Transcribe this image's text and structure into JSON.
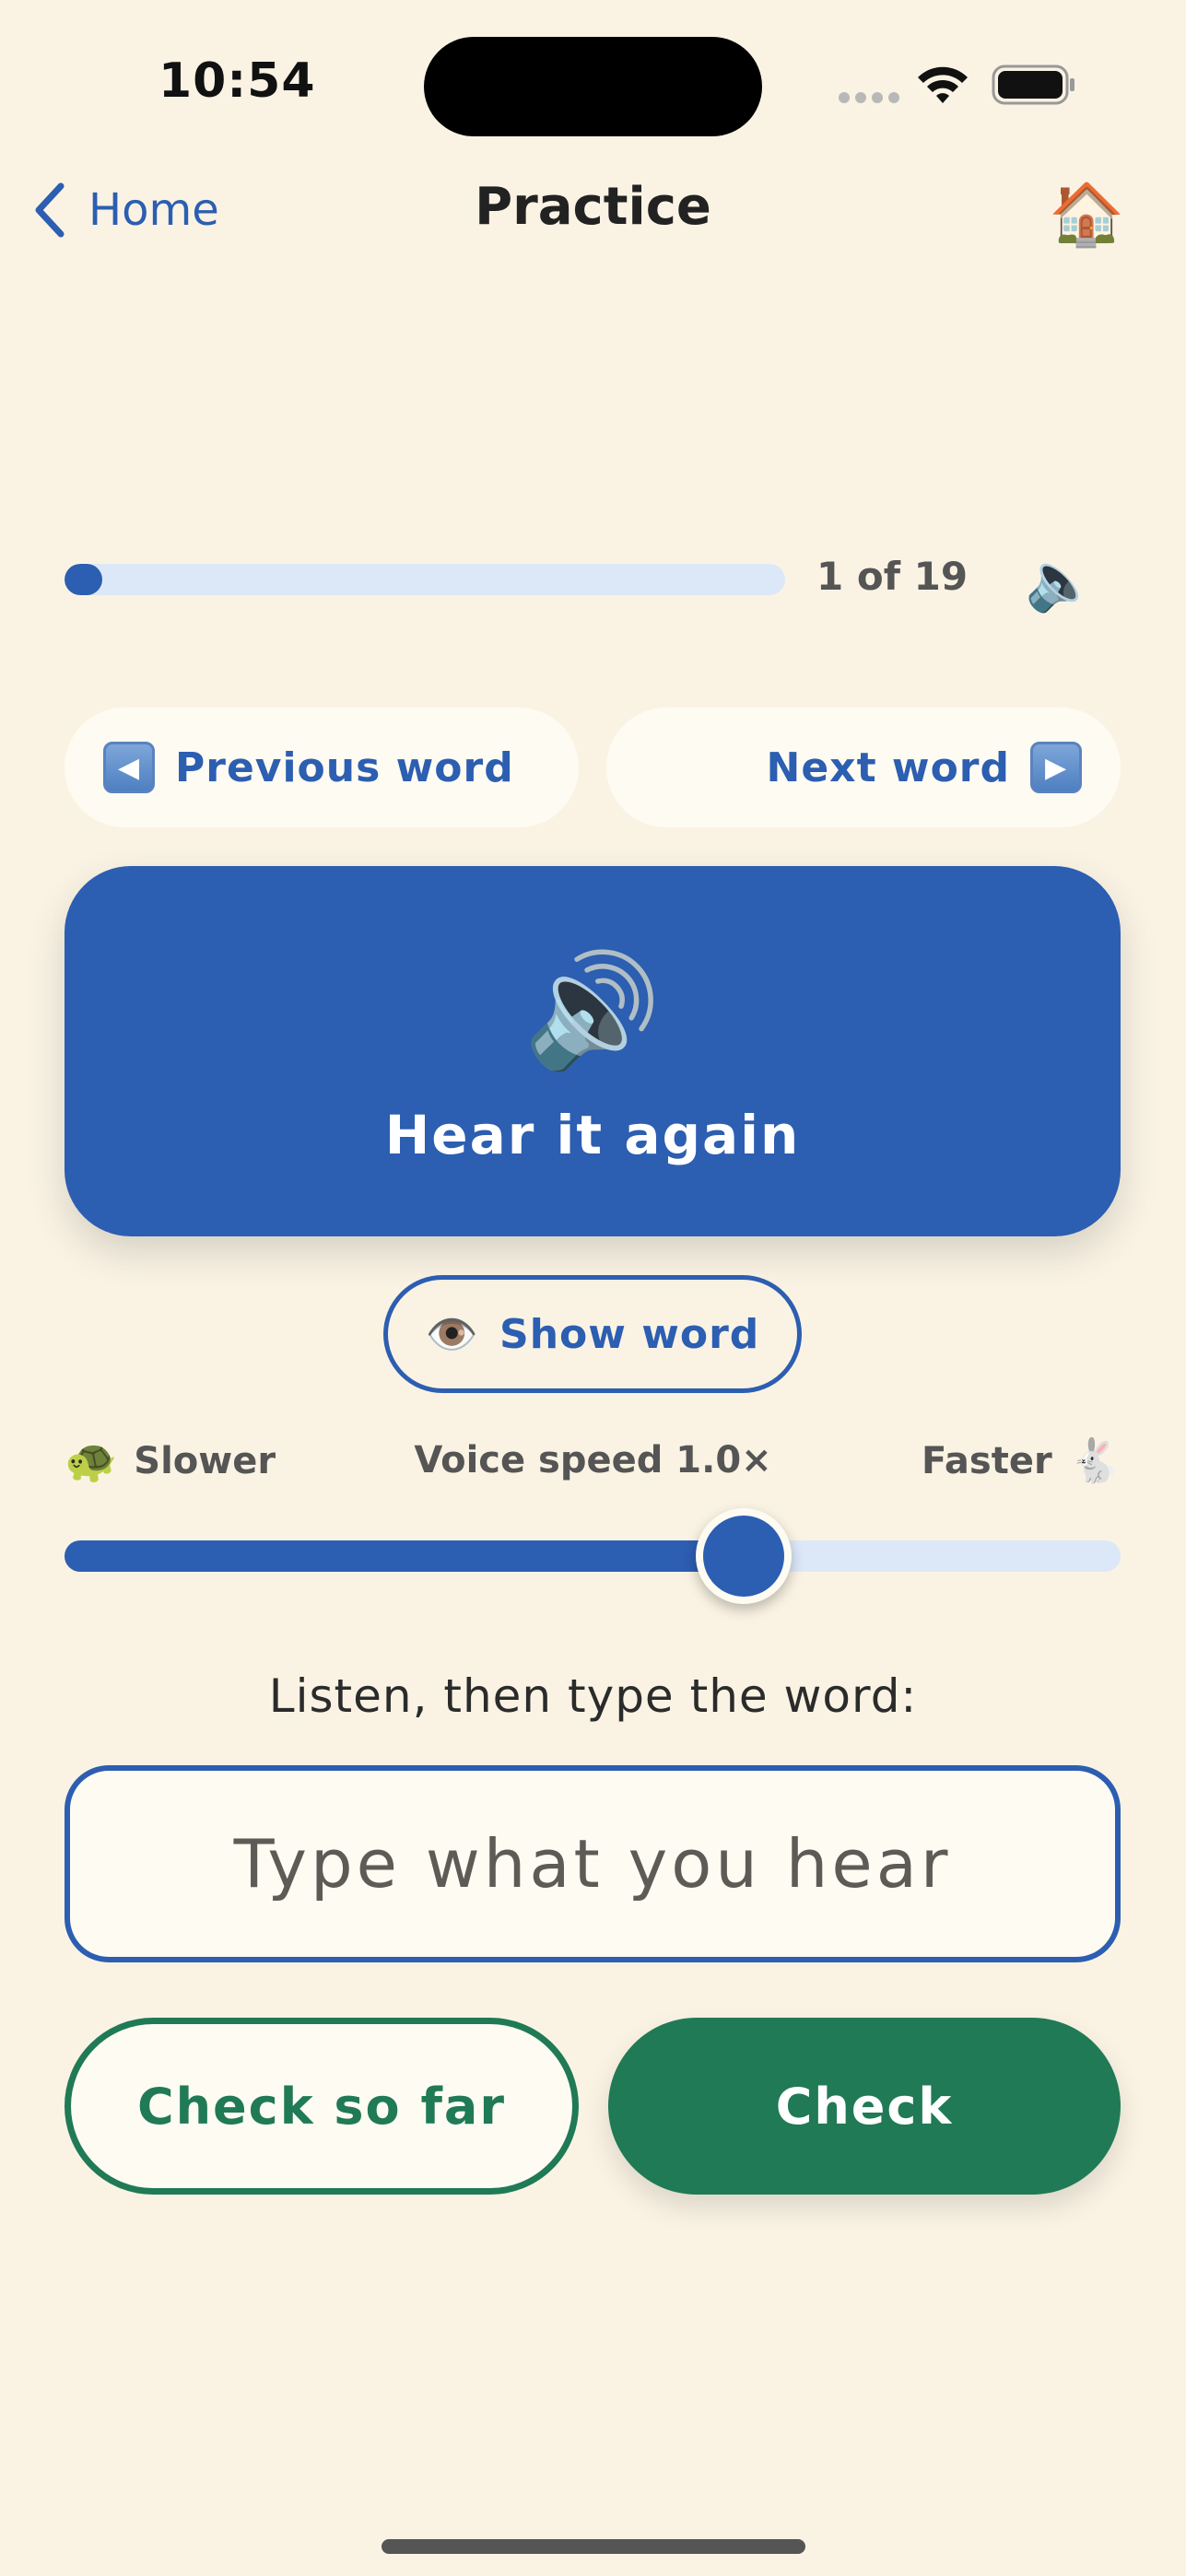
{
  "status_bar": {
    "time": "10:54",
    "icons": [
      "signal-dots-icon",
      "wifi-icon",
      "battery-icon"
    ]
  },
  "nav": {
    "back_label": "Home",
    "title": "Practice",
    "home_icon": "🏠"
  },
  "progress": {
    "label": "1 of 19",
    "current": 1,
    "total": 19,
    "speaker_icon": "🔈"
  },
  "word_nav": {
    "previous_label": "Previous word",
    "next_label": "Next word",
    "previous_icon": "◀",
    "next_icon": "▶"
  },
  "hear": {
    "icon": "🔊",
    "label": "Hear it again"
  },
  "show_word": {
    "icon": "👁️",
    "label": "Show word"
  },
  "speed": {
    "slower_icon": "🐢",
    "slower_label": "Slower",
    "label": "Voice speed 1.0×",
    "faster_label": "Faster",
    "faster_icon": "🐇",
    "level": 0.643
  },
  "prompt": "Listen, then type the word:",
  "answer": {
    "value": "",
    "placeholder": "Type what you hear"
  },
  "actions": {
    "check_so_far_label": "Check so far",
    "check_label": "Check"
  },
  "colors": {
    "background": "#FAF3E4",
    "primary_blue": "#2C5EB1",
    "track_blue": "#DCE8F8",
    "green": "#1F7A55",
    "card": "#FEFBF2"
  }
}
